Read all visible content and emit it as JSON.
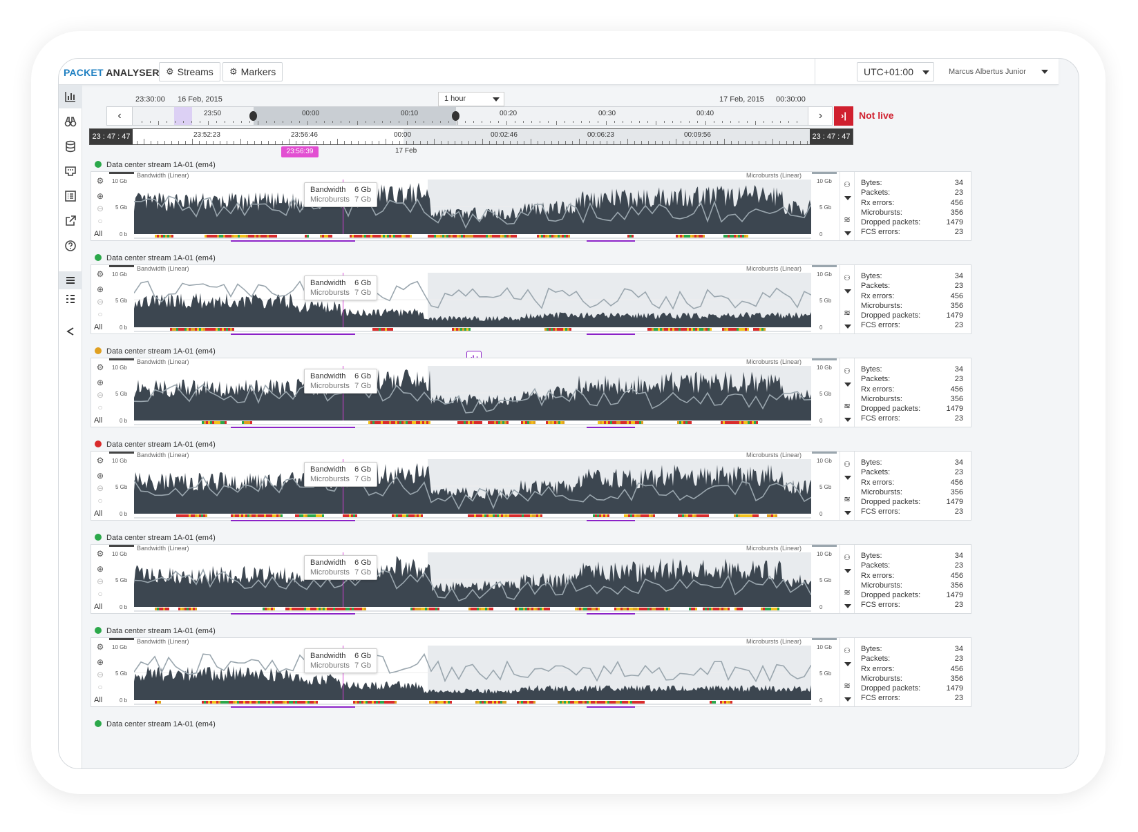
{
  "app": {
    "title_part1": "PACKET",
    "title_part2": " ANALYSER"
  },
  "toolbar": {
    "streams_label": "Streams",
    "markers_label": "Markers",
    "timezone": "UTC+01:00",
    "user": "Marcus Albertus Junior"
  },
  "timeline": {
    "start_time": "23:30:00",
    "start_date": "16 Feb, 2015",
    "end_date": "17 Feb, 2015",
    "end_time": "00:30:00",
    "range": "1 hour",
    "not_live": "Not live",
    "overview_ticks": [
      "23:50",
      "00:00",
      "00:10",
      "00:20",
      "00:30",
      "00:40"
    ],
    "detail_left": "23 : 47 : 47",
    "detail_right": "23 : 47 : 47",
    "detail_ticks": [
      "23:52:23",
      "23:56:46",
      "00:00",
      "00:02:46",
      "00:06:23",
      "00:09:56"
    ],
    "detail_sub": "17 Feb",
    "cursor_time": "23:56:39"
  },
  "colors": {
    "accent": "#1e7fc1",
    "live": "#d0202f",
    "area": "#3c4650",
    "line": "#9aa6ae",
    "cursor": "#d63fd6",
    "ok": "#2ba84a",
    "warn": "#e0a020",
    "err": "#d92b2b",
    "underline": "#8b22c7"
  },
  "panel_labels": {
    "left_title": "Bandwidth (Linear)",
    "right_title": "Microbursts (Linear)",
    "y_left": [
      "10 Gb",
      "5 Gb",
      "0 b"
    ],
    "y_right": [
      "10 Gb",
      "5 Gb",
      "0"
    ],
    "all": "All",
    "tip_bw": "Bandwidth",
    "tip_bw_val": "6 Gb",
    "tip_mb": "Microbursts",
    "tip_mb_val": "7 Gb"
  },
  "stat_labels": [
    "Bytes:",
    "Packets:",
    "Rx errors:",
    "Microbursts:",
    "Dropped packets:",
    "FCS errors:"
  ],
  "streams": [
    {
      "name": "Data center stream 1A-01 (em4)",
      "status": "ok",
      "stats": [
        "34",
        "23",
        "456",
        "356",
        "1479",
        "23"
      ]
    },
    {
      "name": "Data center stream 1A-01 (em4)",
      "status": "ok",
      "stats": [
        "34",
        "23",
        "456",
        "356",
        "1479",
        "23"
      ]
    },
    {
      "name": "Data center stream 1A-01 (em4)",
      "status": "warn",
      "stats": [
        "34",
        "23",
        "456",
        "356",
        "1479",
        "23"
      ]
    },
    {
      "name": "Data center stream 1A-01 (em4)",
      "status": "err",
      "stats": [
        "34",
        "23",
        "456",
        "356",
        "1479",
        "23"
      ]
    },
    {
      "name": "Data center stream 1A-01 (em4)",
      "status": "ok",
      "stats": [
        "34",
        "23",
        "456",
        "356",
        "1479",
        "23"
      ]
    },
    {
      "name": "Data center stream 1A-01 (em4)",
      "status": "ok",
      "stats": [
        "34",
        "23",
        "456",
        "356",
        "1479",
        "23"
      ]
    },
    {
      "name": "Data center stream 1A-01 (em4)",
      "status": "ok"
    }
  ],
  "sidebar_icons": [
    "bar-chart-icon",
    "binoculars-icon",
    "database-icon",
    "ethernet-icon",
    "list-icon",
    "external-link-icon",
    "help-icon",
    "rows-icon",
    "grid-icon",
    "share-icon"
  ]
}
